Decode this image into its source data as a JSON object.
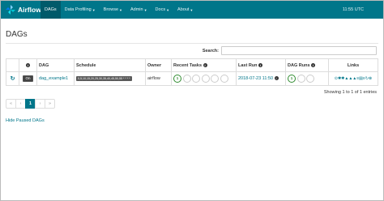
{
  "navbar": {
    "brand": "Airflow",
    "items": [
      {
        "label": "DAGs",
        "caret": false
      },
      {
        "label": "Data Profiling",
        "caret": true
      },
      {
        "label": "Browse",
        "caret": true
      },
      {
        "label": "Admin",
        "caret": true
      },
      {
        "label": "Docs",
        "caret": true
      },
      {
        "label": "About",
        "caret": true
      }
    ],
    "clock": "11:55 UTC"
  },
  "page_title": "DAGs",
  "search": {
    "label": "Search:",
    "value": ""
  },
  "table": {
    "headers": [
      "",
      "ⓘ",
      "DAG",
      "Schedule",
      "Owner",
      "Recent Tasks",
      "Last Run",
      "DAG Runs",
      "Links"
    ],
    "rows": [
      {
        "toggle": "On",
        "dag": "dag_example1",
        "schedule": "0,5,10,15,20,25,30,35,40,45,50,55 * * * *",
        "owner": "airflow",
        "recent_tasks_count": "1",
        "last_run": "2018-07-23 11:50",
        "dag_runs_count": "1"
      }
    ]
  },
  "showing": "Showing 1 to 1 of 1 entries",
  "pagination": [
    "«",
    "‹",
    "1",
    "›",
    "»"
  ],
  "hide_paused": "Hide Paused DAGs",
  "colors": {
    "navbar": "#00768a",
    "active": "#005a6a",
    "success": "#2e8b2e"
  }
}
